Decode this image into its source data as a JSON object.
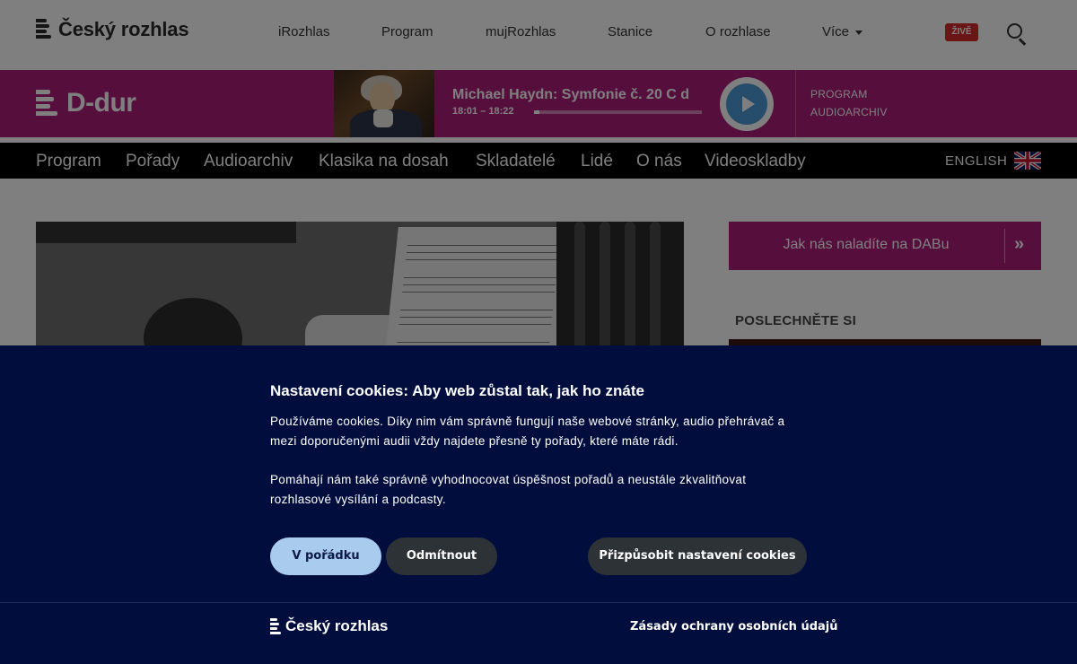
{
  "brand": {
    "name": "Český rozhlas"
  },
  "top_nav": {
    "items": [
      {
        "label": "iRozhlas"
      },
      {
        "label": "Program"
      },
      {
        "label": "mujRozhlas"
      },
      {
        "label": "Stanice"
      },
      {
        "label": "O rozhlase"
      },
      {
        "label": "Více"
      }
    ],
    "live_badge": "ŽIVĚ",
    "search_icon": "search-icon"
  },
  "station": {
    "name": "D-dur",
    "now_playing": {
      "title": "Michael Haydn: Symfonie č. 20 C d",
      "time": "18:01 – 18:22",
      "progress_percent": 3
    },
    "links": [
      "PROGRAM",
      "AUDIOARCHIV"
    ],
    "accent_color": "#ad1f7a"
  },
  "main_nav": {
    "items": [
      {
        "label": "Program"
      },
      {
        "label": "Pořady"
      },
      {
        "label": "Audioarchiv"
      },
      {
        "label": "Klasika na dosah"
      },
      {
        "label": "Skladatelé"
      },
      {
        "label": "Lidé"
      },
      {
        "label": "O nás"
      },
      {
        "label": "Videoskladby"
      }
    ],
    "language": "ENGLISH",
    "flag_icon": "uk-flag-icon"
  },
  "sidebar": {
    "dab_banner": "Jak nás naladíte na DABu",
    "dab_arrows": "»",
    "listen_heading": "POSLECHNĚTE SI"
  },
  "cookie_dialog": {
    "title": "Nastavení cookies: Aby web zůstal tak, jak ho znáte",
    "paragraph_1": "Používáme cookies. Díky nim vám správně fungují naše webové stránky, audio přehrávač a mezi doporučenými audii vždy najdete přesně ty pořady, které máte rádi.",
    "paragraph_2": "Pomáhají nám také správně vyhodnocovat úspěšnost pořadů a neustále zkvalitňovat rozhlasové vysílání a podcasty.",
    "accept_label": "V pořádku",
    "reject_label": "Odmítnout",
    "customize_label": "Přizpůsobit nastavení cookies",
    "footer_brand": "Český rozhlas",
    "privacy_link": "Zásady ochrany osobních údajů",
    "background_color": "#010e3d",
    "accept_color": "#a9cbee"
  }
}
